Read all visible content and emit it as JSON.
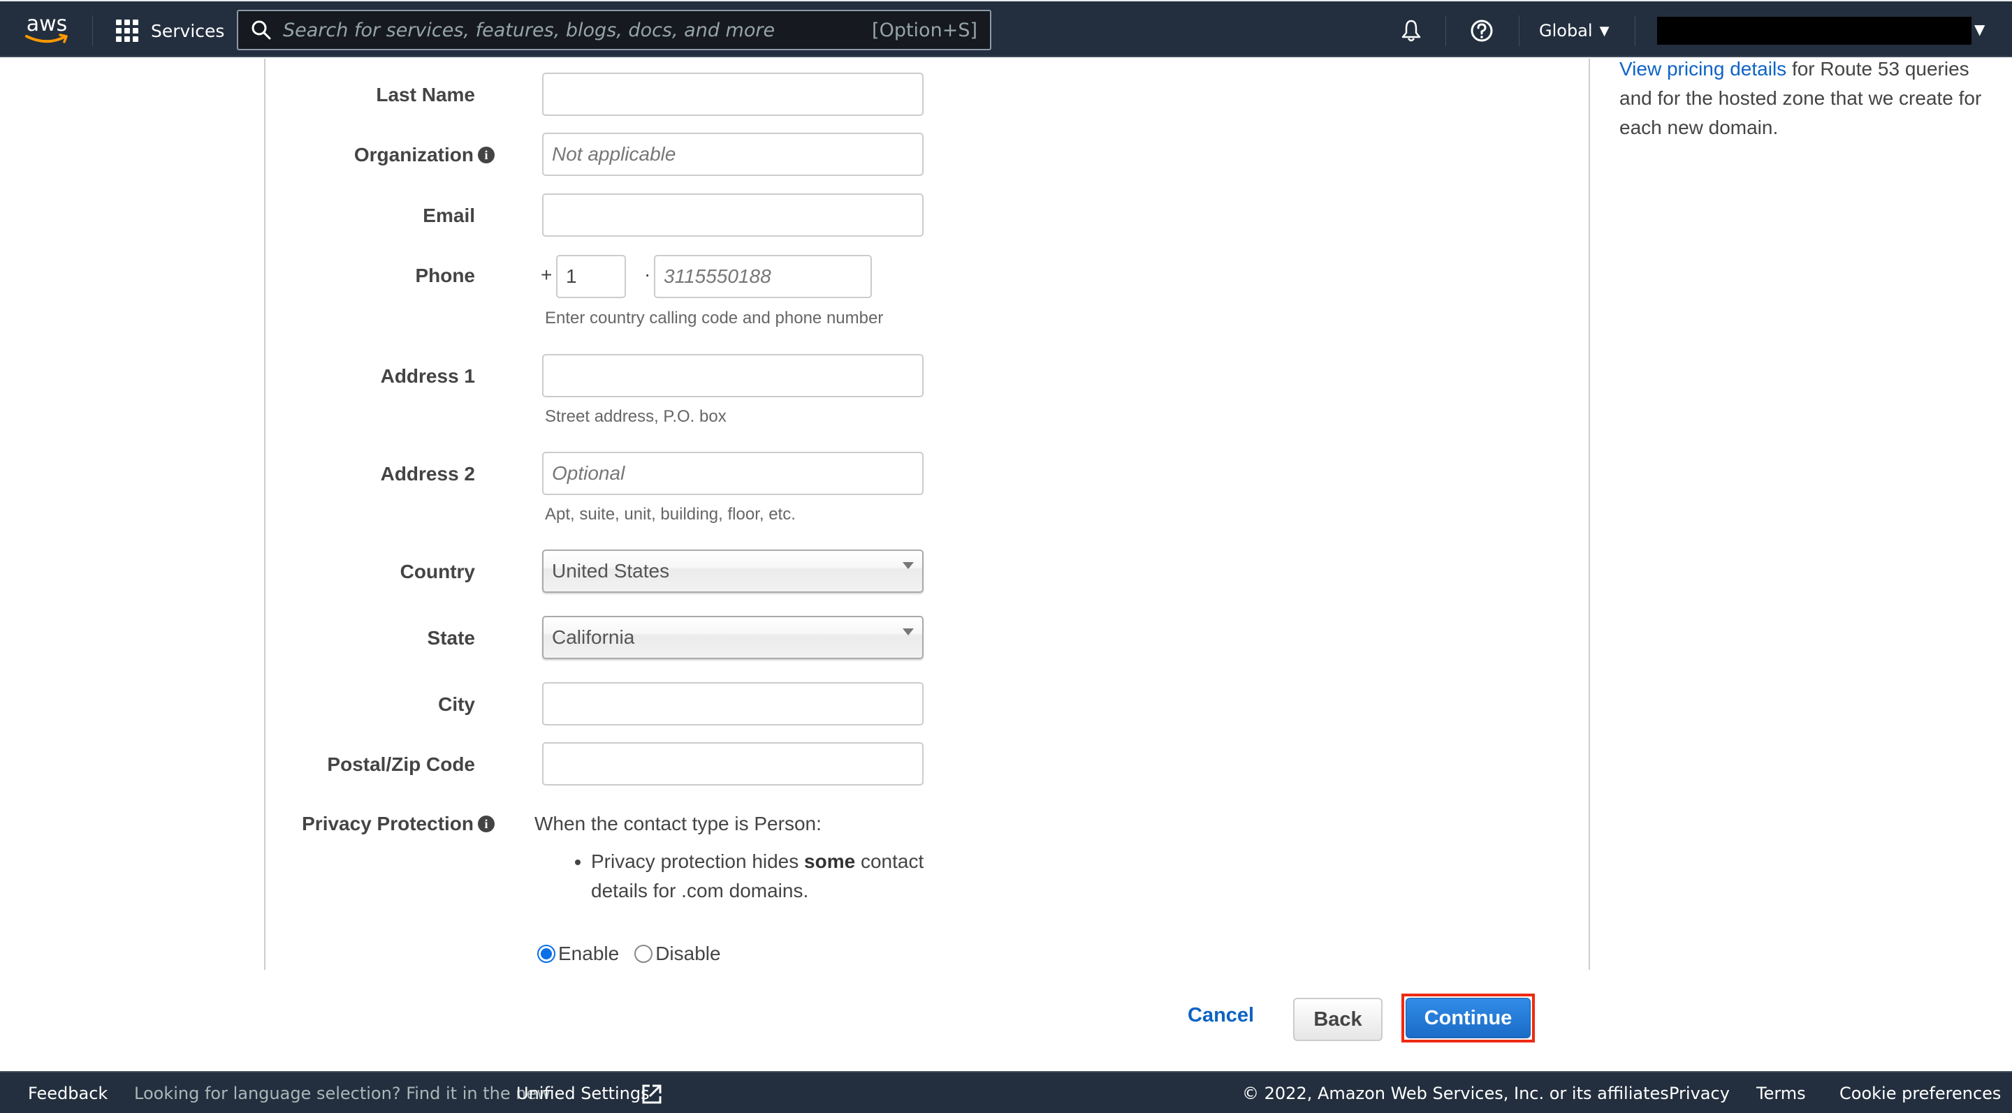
{
  "topnav": {
    "logo_text": "aws",
    "services_label": "Services",
    "search_placeholder": "Search for services, features, blogs, docs, and more",
    "search_shortcut": "[Option+S]",
    "icons": [
      "notifications-bell-icon",
      "help-icon"
    ],
    "region_label": "Global",
    "account_label": ""
  },
  "form": {
    "last_name": {
      "label": "Last Name",
      "value": "",
      "placeholder": ""
    },
    "organization": {
      "label": "Organization",
      "value": "",
      "placeholder": "Not applicable"
    },
    "email": {
      "label": "Email",
      "value": "",
      "placeholder": ""
    },
    "phone": {
      "label": "Phone",
      "plus": "+",
      "separator": "·",
      "country_code": "1",
      "number_placeholder": "3115550188",
      "hint": "Enter country calling code and phone number"
    },
    "address1": {
      "label": "Address 1",
      "value": "",
      "hint": "Street address, P.O. box"
    },
    "address2": {
      "label": "Address 2",
      "value": "",
      "placeholder": "Optional",
      "hint": "Apt, suite, unit, building, floor, etc."
    },
    "country": {
      "label": "Country",
      "selected": "United States"
    },
    "state": {
      "label": "State",
      "selected": "California"
    },
    "city": {
      "label": "City",
      "value": ""
    },
    "postal": {
      "label": "Postal/Zip Code",
      "value": ""
    },
    "privacy": {
      "label": "Privacy Protection",
      "intro": "When the contact type is Person:",
      "bullet_pre": "Privacy protection hides ",
      "bullet_bold": "some",
      "bullet_post": " contact details for .com domains.",
      "options": [
        {
          "label": "Enable",
          "checked": true
        },
        {
          "label": "Disable",
          "checked": false
        }
      ]
    }
  },
  "side_panel": {
    "link_text": "View pricing details",
    "text": " for Route 53 queries and for the hosted zone that we create for each new domain."
  },
  "actions": {
    "cancel": "Cancel",
    "back": "Back",
    "continue": "Continue"
  },
  "footer": {
    "feedback": "Feedback",
    "language_text": "Looking for language selection? Find it in the new",
    "unified_settings": "Unified Settings",
    "copyright": "© 2022, Amazon Web Services, Inc. or its affiliates.",
    "privacy": "Privacy",
    "terms": "Terms",
    "cookie": "Cookie preferences"
  },
  "colors": {
    "nav_bg": "#232f3e",
    "link": "#0e63c4",
    "primary_button": "#1f77d6",
    "highlight_border": "#ee2a12",
    "aws_orange": "#ff9900"
  }
}
